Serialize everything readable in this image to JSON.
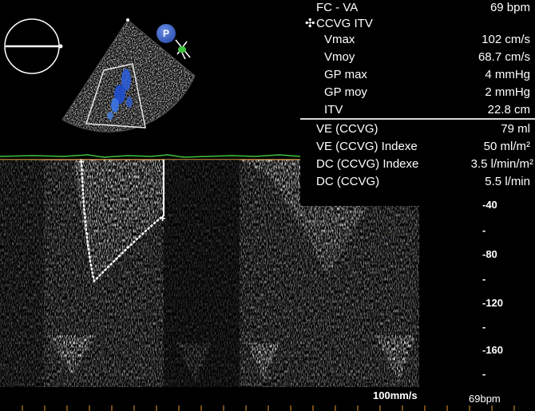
{
  "measurements": {
    "fc_va": {
      "label": "FC - VA",
      "value": "69 bpm"
    },
    "ccvg_itv": {
      "label": "CCVG ITV"
    },
    "vmax": {
      "label": "Vmax",
      "value": "102 cm/s"
    },
    "vmoy": {
      "label": "Vmoy",
      "value": "68.7 cm/s"
    },
    "gp_max": {
      "label": "GP max",
      "value": "4 mmHg"
    },
    "gp_moy": {
      "label": "GP moy",
      "value": "2 mmHg"
    },
    "itv": {
      "label": "ITV",
      "value": "22.8 cm"
    },
    "ve_ccvg": {
      "label": "VE (CCVG)",
      "value": "79 ml"
    },
    "ve_index": {
      "label": "VE (CCVG) Indexe",
      "value": "50 ml/m²"
    },
    "dc_index": {
      "label": "DC (CCVG) Indexe",
      "value": "3.5 l/min/m²"
    },
    "dc_ccvg": {
      "label": "DC (CCVG)",
      "value": "5.5 l/min"
    }
  },
  "scale": {
    "ticks": [
      "-40",
      "-80",
      "-120",
      "-160"
    ],
    "minor": [
      "-",
      "-",
      "-",
      "-"
    ]
  },
  "sweep_speed": "100mm/s",
  "heart_rate": "69bpm",
  "probe_marker": "P",
  "icons": {
    "orientation": "orientation-circle-icon",
    "probe": "probe-p-icon",
    "cursor": "cursor-cross-icon"
  },
  "colors": {
    "doppler_flow": "#2b5fe0",
    "ecg_trace": "#3ec43e",
    "baseline": "#c98a3c",
    "tick_marks": "#c97a2a"
  }
}
